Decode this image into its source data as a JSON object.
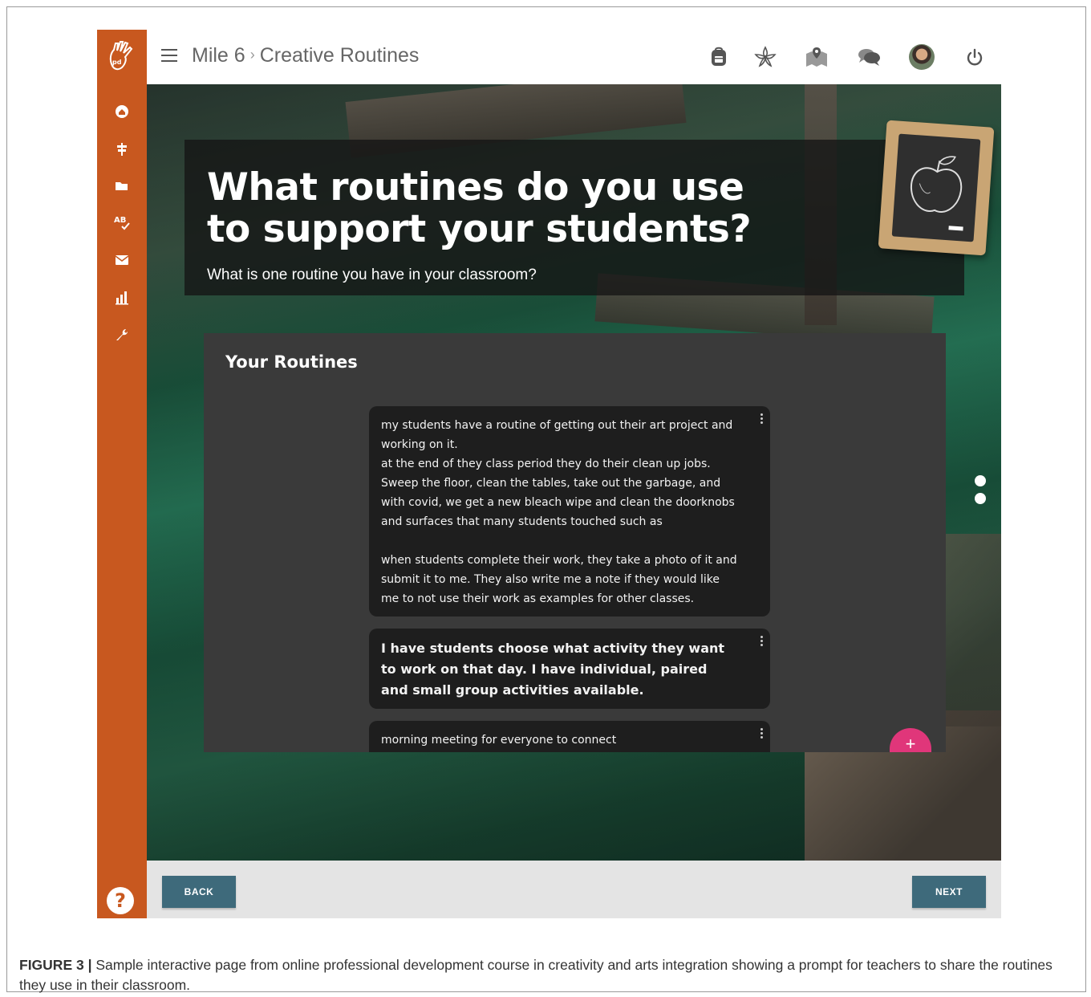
{
  "breadcrumb": {
    "parent": "Mile 6",
    "separator": "›",
    "current": "Creative Routines"
  },
  "sidebar": {
    "logo_icon": "handprint-logo-icon",
    "items": [
      {
        "icon": "home-icon"
      },
      {
        "icon": "signpost-icon"
      },
      {
        "icon": "folder-icon"
      },
      {
        "icon": "spellcheck-icon"
      },
      {
        "icon": "envelope-icon"
      },
      {
        "icon": "bar-chart-icon"
      },
      {
        "icon": "wrench-icon"
      }
    ],
    "help_label": "?"
  },
  "topbar": {
    "icons": [
      "backpack-icon",
      "lily-flower-icon",
      "map-pin-icon",
      "chat-bubbles-icon",
      "user-avatar",
      "power-icon"
    ]
  },
  "question": {
    "title": "What routines do you use to support your students?",
    "subtitle": "What is one routine you have in your classroom?"
  },
  "routines_panel": {
    "title": "Your Routines",
    "cards": [
      {
        "text": "my students have a routine of getting out their art project and working on it.\nat the end of they class period they do their clean up jobs. Sweep the floor, clean the tables, take out the garbage, and with covid, we get a new bleach wipe and clean the doorknobs and surfaces that many students touched such as\n\nwhen students complete their work, they take a photo of it and submit it to me. They also write me a note if they would like me to not use their work as examples for other classes."
      },
      {
        "text": "I have students choose what activity they want to work on that day. I have individual, paired and small group activities available."
      },
      {
        "text": "morning meeting for everyone to connect"
      }
    ],
    "add_label": "+"
  },
  "pager": {
    "count": 2
  },
  "footer": {
    "back_label": "BACK",
    "next_label": "NEXT"
  },
  "caption": {
    "label": "FIGURE 3 |",
    "text": " Sample interactive page from online professional development course in creativity and arts integration showing a prompt for teachers to share the routines they use in their classroom."
  },
  "colors": {
    "sidebar": "#c8581f",
    "button": "#3e6a7b",
    "fab": "#e0367a",
    "card": "#1e1e1e",
    "panel": "#3a3a3a"
  }
}
